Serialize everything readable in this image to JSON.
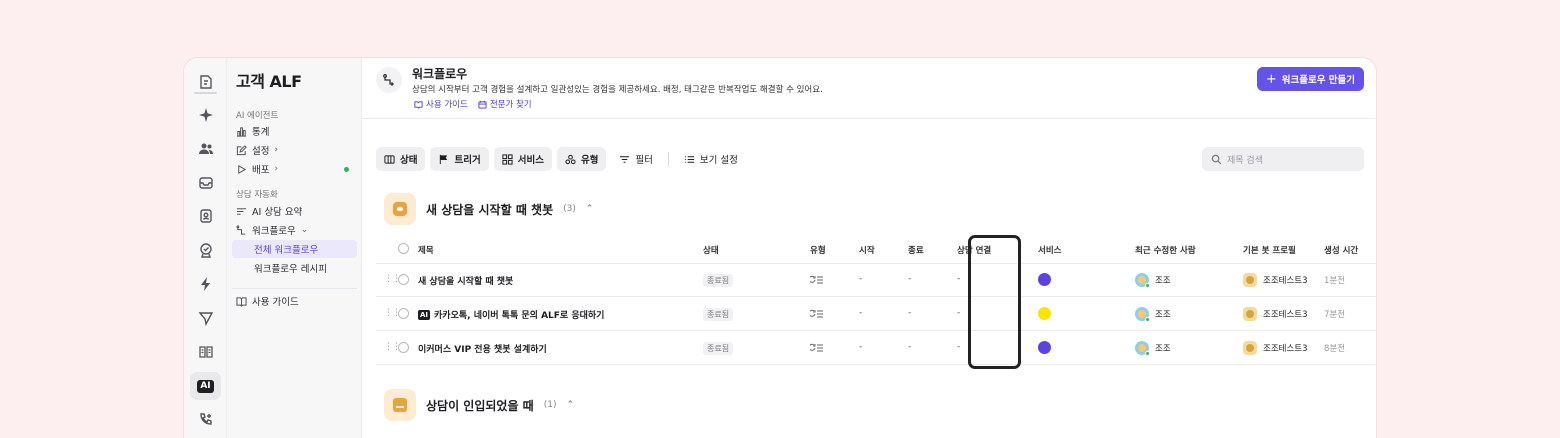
{
  "sidebar": {
    "brand": "고객 ALF",
    "section_ai_agent": "AI 에이전트",
    "stats": "통계",
    "settings": "설정",
    "deploy": "배포",
    "section_automation": "상담 자동화",
    "ai_summary": "AI 상담 요약",
    "workflow": "워크플로우",
    "all_workflows": "전체 워크플로우",
    "workflow_recipes": "워크플로우 레시피",
    "user_guide": "사용 가이드",
    "rail_ai_label": "AI"
  },
  "header": {
    "title": "워크플로우",
    "description": "상담의 시작부터 고객 경험을 설계하고 일관성있는 경험을 제공하세요. 배정, 태그같은 반복작업도 해결할 수 있어요.",
    "link_guide": "사용 가이드",
    "link_expert": "전문가 찾기",
    "create_button": "워크플로우 만들기"
  },
  "toolbar": {
    "status": "상태",
    "trigger": "트리거",
    "service": "서비스",
    "type": "유형",
    "filter": "필터",
    "view_settings": "보기 설정",
    "search_placeholder": "제목 검색"
  },
  "group1": {
    "title": "새 상담을 시작할 때 챗봇",
    "count": "(3)"
  },
  "group2": {
    "title": "상담이 인입되었을 때",
    "count": "(1)"
  },
  "table": {
    "headers": {
      "title": "제목",
      "status": "상태",
      "type": "유형",
      "start": "시작",
      "end": "종료",
      "connect": "상담 연결",
      "service": "서비스",
      "modifier": "최근 수정한 사람",
      "bot_profile": "기본 봇 프로필",
      "created": "생성 시간"
    },
    "rows": [
      {
        "ai_tag": "",
        "title": "새 상담을 시작할 때 챗봇",
        "status": "종료됨",
        "start": "-",
        "end": "-",
        "connect": "-",
        "service": "channel-talk",
        "modifier": "조조",
        "bot": "조조테스트3",
        "created": "1분전"
      },
      {
        "ai_tag": "AI",
        "title": "카카오톡, 네이버 톡톡 문의 ALF로 응대하기",
        "status": "종료됨",
        "start": "-",
        "end": "-",
        "connect": "-",
        "service": "kakaotalk",
        "modifier": "조조",
        "bot": "조조테스트3",
        "created": "7분전"
      },
      {
        "ai_tag": "",
        "title": "이커머스 VIP 전용 챗봇 설계하기",
        "status": "종료됨",
        "start": "-",
        "end": "-",
        "connect": "-",
        "service": "channel-talk",
        "modifier": "조조",
        "bot": "조조테스트3",
        "created": "8분전"
      }
    ]
  },
  "colors": {
    "accent": "#6552e6",
    "page_bg": "#fdeef0",
    "active_nav": "#ebe8fb"
  }
}
